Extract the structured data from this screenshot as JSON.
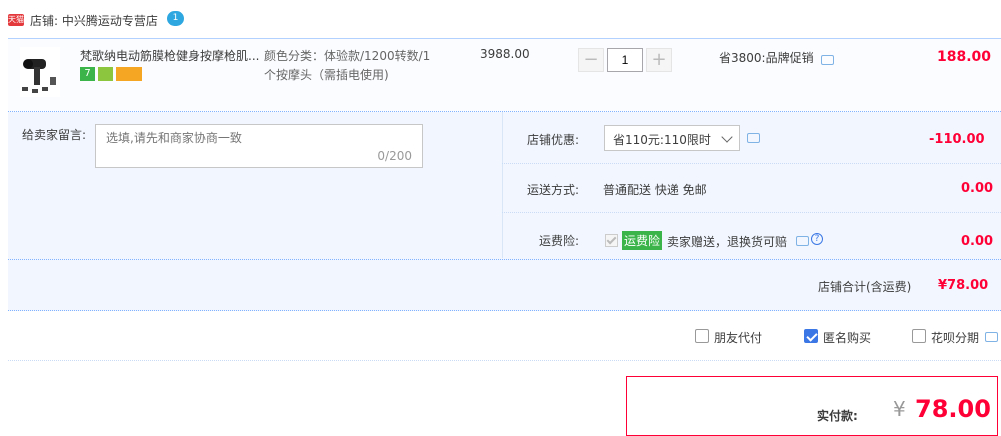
{
  "store": {
    "badge": "天猫",
    "label": "店铺: 中兴腾运动专营店",
    "chat_badge": "1"
  },
  "item": {
    "title": "梵歌纳电动筋膜枪健身按摩枪肌...",
    "badges": [
      "7",
      "",
      ""
    ],
    "sku_line1": "颜色分类：体验款/1200转数/1",
    "sku_line2": "个按摩头（需插电使用)",
    "price": "3988.00",
    "qty": "1",
    "qty_minus": "−",
    "qty_plus": "+",
    "promo": "省3800:品牌促销",
    "subtotal": "188.00"
  },
  "note": {
    "label": "给卖家留言:",
    "placeholder": "选填,请先和商家协商一致",
    "count": "0/200"
  },
  "store_discount": {
    "label": "店铺优惠:",
    "selected": "省110元:110限时",
    "amount": "-110.00"
  },
  "shipping": {
    "label": "运送方式:",
    "value": "普通配送 快递 免邮",
    "amount": "0.00"
  },
  "insurance": {
    "label": "运费险:",
    "tag": "运费险",
    "desc": "卖家赠送，退换货可赔",
    "amount": "0.00"
  },
  "store_total": {
    "label": "店铺合计(含运费)",
    "amount": "¥78.00"
  },
  "pay_options": [
    {
      "label": "朋友代付",
      "checked": false
    },
    {
      "label": "匿名购买",
      "checked": true
    },
    {
      "label": "花呗分期",
      "checked": false
    }
  ],
  "actual_pay": {
    "label": "实付款:",
    "currency": "¥",
    "amount": "78.00"
  },
  "colors": {
    "accent": "#ff0036",
    "blue": "#3b77e5",
    "panel": "#f2f7ff"
  }
}
